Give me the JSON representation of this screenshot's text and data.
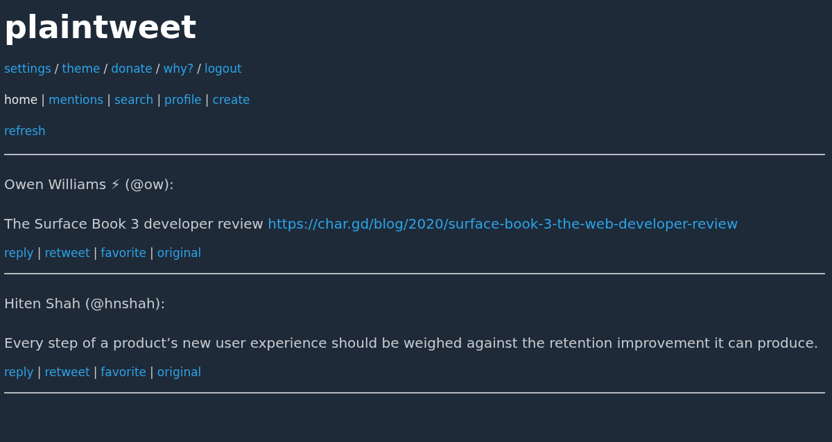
{
  "title": "plaintweet",
  "nav_rows": [
    {
      "items": [
        {
          "kind": "link",
          "label": "settings",
          "selected": false
        },
        {
          "kind": "separator",
          "label": "/"
        },
        {
          "kind": "link",
          "label": "theme",
          "selected": false
        },
        {
          "kind": "separator",
          "label": "/"
        },
        {
          "kind": "link",
          "label": "donate",
          "selected": false
        },
        {
          "kind": "separator",
          "label": "/"
        },
        {
          "kind": "link",
          "label": "why?",
          "selected": false
        },
        {
          "kind": "separator",
          "label": "/"
        },
        {
          "kind": "link",
          "label": "logout",
          "selected": false
        }
      ]
    },
    {
      "items": [
        {
          "kind": "link",
          "label": "home",
          "selected": true
        },
        {
          "kind": "separator",
          "label": "|"
        },
        {
          "kind": "link",
          "label": "mentions",
          "selected": false
        },
        {
          "kind": "separator",
          "label": "|"
        },
        {
          "kind": "link",
          "label": "search",
          "selected": false
        },
        {
          "kind": "separator",
          "label": "|"
        },
        {
          "kind": "link",
          "label": "profile",
          "selected": false
        },
        {
          "kind": "separator",
          "label": "|"
        },
        {
          "kind": "link",
          "label": "create",
          "selected": false
        }
      ]
    },
    {
      "items": [
        {
          "kind": "link",
          "label": "refresh",
          "selected": false
        }
      ]
    }
  ],
  "tweets": [
    {
      "author": "Owen Williams ⚡ (@ow):",
      "text": "The Surface Book 3 developer review ",
      "link": "https://char.gd/blog/2020/surface-book-3-the-web-developer-review",
      "actions": [
        {
          "kind": "link",
          "label": "reply"
        },
        {
          "kind": "separator",
          "label": "|"
        },
        {
          "kind": "link",
          "label": "retweet"
        },
        {
          "kind": "separator",
          "label": "|"
        },
        {
          "kind": "link",
          "label": "favorite"
        },
        {
          "kind": "separator",
          "label": "|"
        },
        {
          "kind": "link",
          "label": "original"
        }
      ]
    },
    {
      "author": "Hiten Shah (@hnshah):",
      "text": "Every step of a product’s new user experience should be weighed against the retention improvement it can produce.",
      "actions": [
        {
          "kind": "link",
          "label": "reply"
        },
        {
          "kind": "separator",
          "label": "|"
        },
        {
          "kind": "link",
          "label": "retweet"
        },
        {
          "kind": "separator",
          "label": "|"
        },
        {
          "kind": "link",
          "label": "favorite"
        },
        {
          "kind": "separator",
          "label": "|"
        },
        {
          "kind": "link",
          "label": "original"
        }
      ]
    }
  ]
}
